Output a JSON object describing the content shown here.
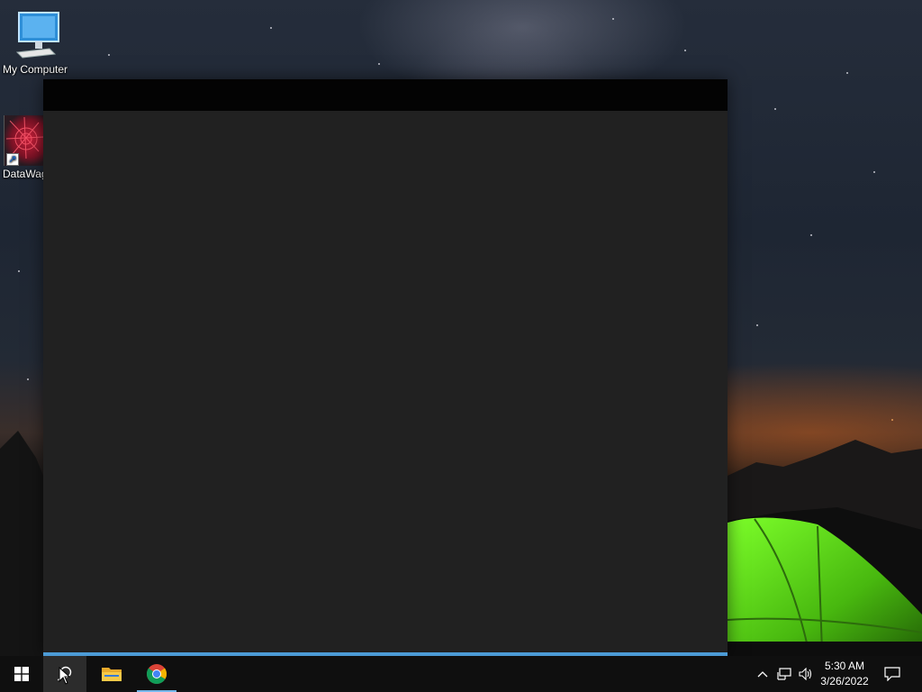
{
  "desktop": {
    "icons": [
      {
        "name": "my-computer",
        "label": "My Computer",
        "icon": "computer-icon"
      },
      {
        "name": "datawag",
        "label": "DataWag",
        "icon": "datawag-app-icon",
        "shortcut": true
      }
    ]
  },
  "window": {
    "title": "",
    "theme": {
      "titlebar": "#030303",
      "client": "#212121",
      "accent": "#4c9bd6"
    }
  },
  "taskbar": {
    "pinned": [
      {
        "name": "start",
        "icon": "windows-logo-icon"
      },
      {
        "name": "search",
        "icon": "search-icon",
        "active": true
      },
      {
        "name": "file-explorer",
        "icon": "folder-icon"
      },
      {
        "name": "chrome",
        "icon": "chrome-icon",
        "running": true
      }
    ],
    "tray": {
      "icons": [
        "chevron-up-icon",
        "network-icon",
        "volume-icon"
      ],
      "time": "5:30 AM",
      "date": "3/26/2022"
    },
    "notification_icon": "notification-icon"
  }
}
